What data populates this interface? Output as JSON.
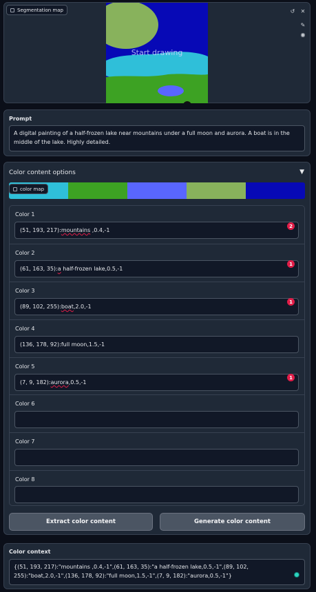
{
  "seg_panel": {
    "tag_label": "Segmentation map",
    "canvas_hint": "Start drawing",
    "undo_icon": "undo-icon",
    "brush_icon": "brush-icon",
    "palette_icon": "palette-icon"
  },
  "prompt": {
    "label": "Prompt",
    "text": "A digital painting of a half-frozen lake near mountains under a full moon and aurora. A boat is in the middle of the lake. Highly detailed."
  },
  "options": {
    "title": "Color content options",
    "color_map_tag": "color map",
    "swatches": [
      "#2fbfd9",
      "#3da223",
      "#5966ff",
      "#88b25c",
      "#0709b6"
    ],
    "colors": [
      {
        "label": "Color 1",
        "pre": "(51, 193, 217):",
        "flag": "mountains",
        "post": " ,0.4,-1",
        "badge": "2"
      },
      {
        "label": "Color 2",
        "pre": "(61, 163, 35):",
        "flag": "a",
        "post": " half-frozen lake,0.5,-1",
        "badge": "1"
      },
      {
        "label": "Color 3",
        "pre": "(89, 102, 255):",
        "flag": "boat",
        "post": ",2.0,-1",
        "badge": "1"
      },
      {
        "label": "Color 4",
        "pre": "(136, 178, 92):full moon,1.5,-1",
        "flag": "",
        "post": "",
        "badge": ""
      },
      {
        "label": "Color 5",
        "pre": "(7, 9, 182):",
        "flag": "aurora",
        "post": ",0.5,-1",
        "badge": "1"
      },
      {
        "label": "Color 6",
        "pre": "",
        "flag": "",
        "post": "",
        "badge": ""
      },
      {
        "label": "Color 7",
        "pre": "",
        "flag": "",
        "post": "",
        "badge": ""
      },
      {
        "label": "Color 8",
        "pre": "",
        "flag": "",
        "post": "",
        "badge": ""
      }
    ],
    "extract_button": "Extract color content",
    "generate_button": "Generate color content"
  },
  "context": {
    "label": "Color context",
    "text": "{(51, 193, 217):\"mountains ,0.4,-1\",(61, 163, 35):\"a half-frozen lake,0.5,-1\",(89, 102, 255):\"boat,2.0,-1\",(136, 178, 92):\"full moon,1.5,-1\",(7, 9, 182):\"aurora,0.5,-1\"}"
  },
  "colors": {
    "canvas_blue": "#0709b6",
    "moon": "#88b25c",
    "water": "#2fbfd9",
    "grass": "#3da223",
    "boat": "#5966ff",
    "badge": "#e11d48"
  }
}
